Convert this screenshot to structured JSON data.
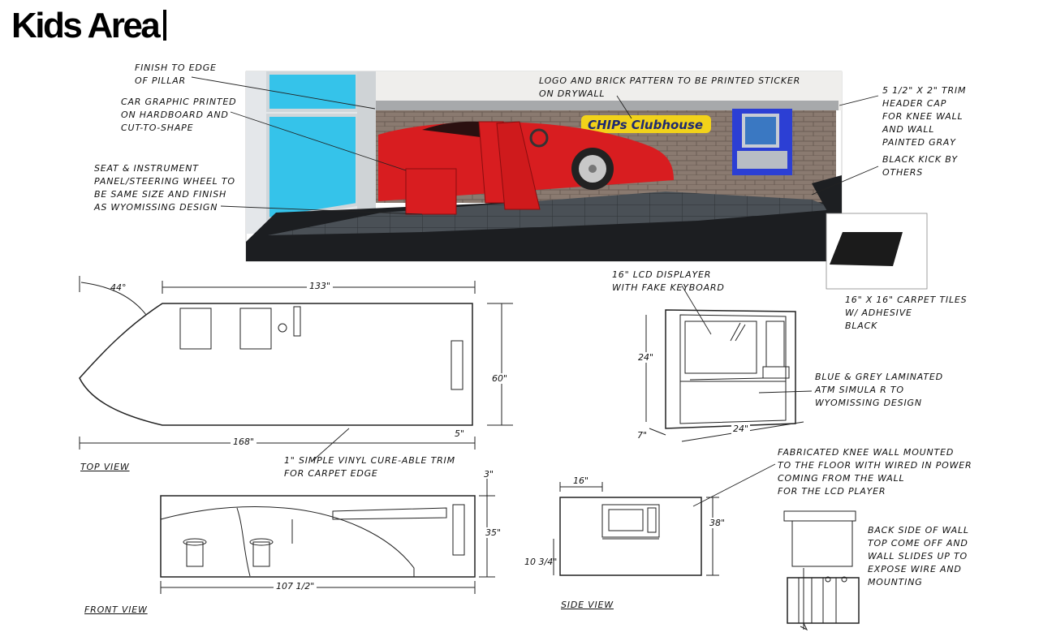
{
  "page": {
    "title": "Kids Area"
  },
  "rendering": {
    "logo_text": "CHIPs Clubhouse",
    "colors": {
      "car_red": "#d81d20",
      "wall_brick": "#8a7a70",
      "floor": "#3e4348",
      "atm_blue": "#2c3fd4",
      "window_blue": "#35c3ea",
      "logo_yellow": "#f2d21a"
    }
  },
  "callouts": {
    "finish_pillar": "Finish to edge\nof pillar",
    "car_graphic": "Car graphic printed\non hardboard and\ncut-to-shape",
    "seat_panel": "Seat & instrument\npanel/steering wheel to\nbe same size and finish\nas Wyomissing design",
    "logo_brick": "Logo and brick pattern to be printed sticker\non drywall",
    "trim_header": "5 1/2\" x 2\" trim\nheader cap\nfor knee wall\nand wall\npainted gray",
    "black_kick": "Black kick by\nothers",
    "carpet_tiles": "16\" x 16\" carpet tiles\nw/ adhesive\nblack",
    "lcd_displayer": "16\" LCD displayer\nwith fake keyboard",
    "atm_simular": "Blue & grey laminated\nATM simula r to\nWyomissing design",
    "knee_wall": "Fabricated knee wall mounted\nto the floor with wired in power\ncoming from the wall\nfor the LCD player",
    "back_side": "Back side of wall\ntop come off and\nwall slides up to\nexpose wire and\nmounting",
    "vinyl_trim": "1\" simple vinyl cure-able trim\nfor carpet edge"
  },
  "views": {
    "top": "Top view",
    "front": "Front view",
    "side": "Side view"
  },
  "dimensions": {
    "angle": "44°",
    "top_length": "133\"",
    "top_total": "168\"",
    "top_depth": "60\"",
    "top_offset": "5\"",
    "front_length": "107 1/2\"",
    "front_top": "3\"",
    "front_height": "35\"",
    "side_width": "16\"",
    "side_height": "38\"",
    "side_offset": "10 3/4\"",
    "atm_height": "24\"",
    "atm_width": "24\"",
    "atm_depth": "7\""
  }
}
